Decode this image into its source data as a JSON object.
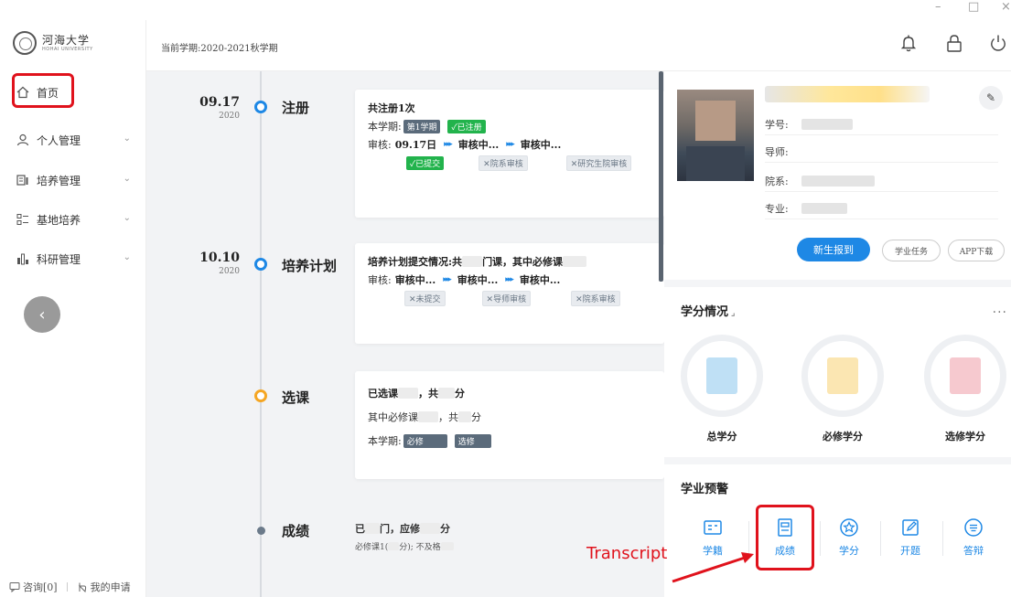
{
  "university": {
    "name": "河海大学",
    "name_en": "HOHAI UNIVERSITY"
  },
  "sidebar": {
    "items": [
      {
        "label": "首页",
        "icon": "home-icon"
      },
      {
        "label": "个人管理",
        "icon": "person-icon"
      },
      {
        "label": "培养管理",
        "icon": "chart-doc-icon"
      },
      {
        "label": "基地培养",
        "icon": "list-icon"
      },
      {
        "label": "科研管理",
        "icon": "bar-chart-icon"
      }
    ],
    "footer": {
      "consult": "咨询[0]",
      "my_applications": "我的申请"
    }
  },
  "header": {
    "term": "当前学期:2020-2021秋学期"
  },
  "timeline": [
    {
      "date": "09.17",
      "year": "2020",
      "title": "注册",
      "line1": "共注册1次",
      "semester_label": "本学期:",
      "semester_tag": "第1学期",
      "status_tag": "✓已注册",
      "review_label": "审核:",
      "steps": [
        {
          "top": "09.17日",
          "tag": "✓已提交"
        },
        {
          "top": "审核中...",
          "tag": "✕院系审核"
        },
        {
          "top": "审核中...",
          "tag": "✕研究生院审核"
        }
      ]
    },
    {
      "date": "10.10",
      "year": "2020",
      "title": "培养计划",
      "line1_a": "培养计划提交情况:共",
      "line1_b": "门课，其中必修课",
      "review_label": "审核:",
      "steps": [
        {
          "top": "审核中...",
          "tag": "✕未提交"
        },
        {
          "top": "审核中...",
          "tag": "✕导师审核"
        },
        {
          "top": "审核中...",
          "tag": "✕院系审核"
        }
      ]
    },
    {
      "title": "选课",
      "line1_a": "已选课",
      "line1_b": "，共",
      "line1_c": "分",
      "line2_a": "其中必修课",
      "line2_b": "，共",
      "line2_c": "分",
      "semester_label": "本学期:",
      "tag1": "必修",
      "tag2": "选修"
    },
    {
      "title": "成绩",
      "line1_a": "已",
      "line1_b": "门，应修",
      "line1_c": "分",
      "line2_a": "必修课1(",
      "line2_b": "分); 不及格"
    }
  ],
  "profile": {
    "fields": [
      {
        "label": "学号:"
      },
      {
        "label": "导师:"
      },
      {
        "label": "院系:"
      },
      {
        "label": "专业:"
      }
    ],
    "primary_button": "新生报到",
    "task_button": "学业任务",
    "app_button": "APP下载"
  },
  "credits": {
    "title": "学分情况",
    "more": "...",
    "items": [
      {
        "label": "总学分",
        "color": "#bfe0f5"
      },
      {
        "label": "必修学分",
        "color": "#fbe6b2"
      },
      {
        "label": "选修学分",
        "color": "#f6c9cf"
      }
    ]
  },
  "warning": {
    "title": "学业预警",
    "items": [
      {
        "label": "学籍",
        "icon": "id-card-icon"
      },
      {
        "label": "成绩",
        "icon": "transcript-icon"
      },
      {
        "label": "学分",
        "icon": "star-badge-icon"
      },
      {
        "label": "开题",
        "icon": "edit-icon"
      },
      {
        "label": "答辩",
        "icon": "speech-icon"
      }
    ]
  },
  "annotation": {
    "text": "Transcript",
    "color": "#e0121c"
  },
  "colors": {
    "primary": "#1e88e5",
    "success": "#22b34c",
    "highlight": "#e0121c"
  }
}
